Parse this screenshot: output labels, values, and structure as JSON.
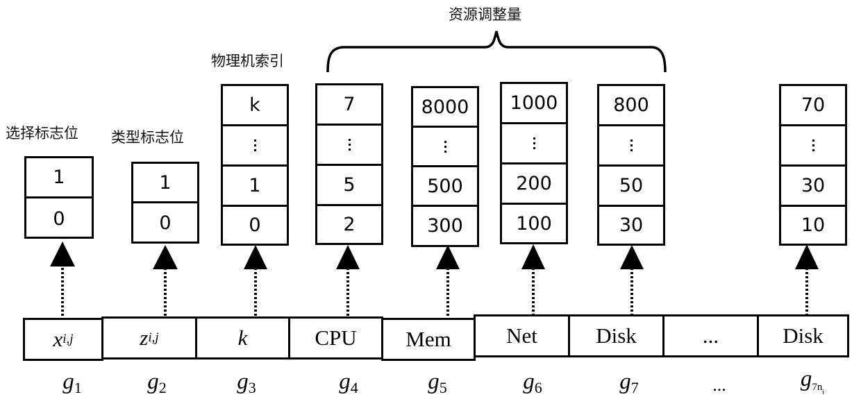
{
  "labels": {
    "selection_flag": "选择标志位",
    "type_flag": "类型标志位",
    "pm_index": "物理机索引",
    "resource_adjust": "资源调整量"
  },
  "stacks": [
    {
      "name": "selection-flag",
      "cells": [
        "1",
        "0"
      ]
    },
    {
      "name": "type-flag",
      "cells": [
        "1",
        "0"
      ]
    },
    {
      "name": "pm-index",
      "cells": [
        "k",
        "⋮",
        "1",
        "0"
      ]
    },
    {
      "name": "cpu",
      "cells": [
        "7",
        "⋮",
        "5",
        "2"
      ]
    },
    {
      "name": "mem",
      "cells": [
        "8000",
        "⋮",
        "500",
        "300"
      ]
    },
    {
      "name": "net",
      "cells": [
        "1000",
        "⋮",
        "200",
        "100"
      ]
    },
    {
      "name": "disk",
      "cells": [
        "800",
        "⋮",
        "50",
        "30"
      ]
    },
    {
      "name": "disk-last",
      "cells": [
        "70",
        "⋮",
        "30",
        "10"
      ]
    }
  ],
  "genes": [
    {
      "base": "x",
      "sub": "i,j"
    },
    {
      "base": "z",
      "sub": "i,j"
    },
    {
      "base": "k",
      "sub": ""
    },
    {
      "text": "CPU"
    },
    {
      "text": "Mem"
    },
    {
      "text": "Net"
    },
    {
      "text": "Disk"
    },
    {
      "text": "..."
    },
    {
      "text": "Disk"
    }
  ],
  "gene_labels": [
    {
      "base": "g",
      "sub": "1"
    },
    {
      "base": "g",
      "sub": "2"
    },
    {
      "base": "g",
      "sub": "3"
    },
    {
      "base": "g",
      "sub": "4"
    },
    {
      "base": "g",
      "sub": "5"
    },
    {
      "base": "g",
      "sub": "6"
    },
    {
      "base": "g",
      "sub": "7"
    },
    {
      "text": "..."
    },
    {
      "base": "g",
      "sub": "7n",
      "sub2": "i"
    }
  ]
}
